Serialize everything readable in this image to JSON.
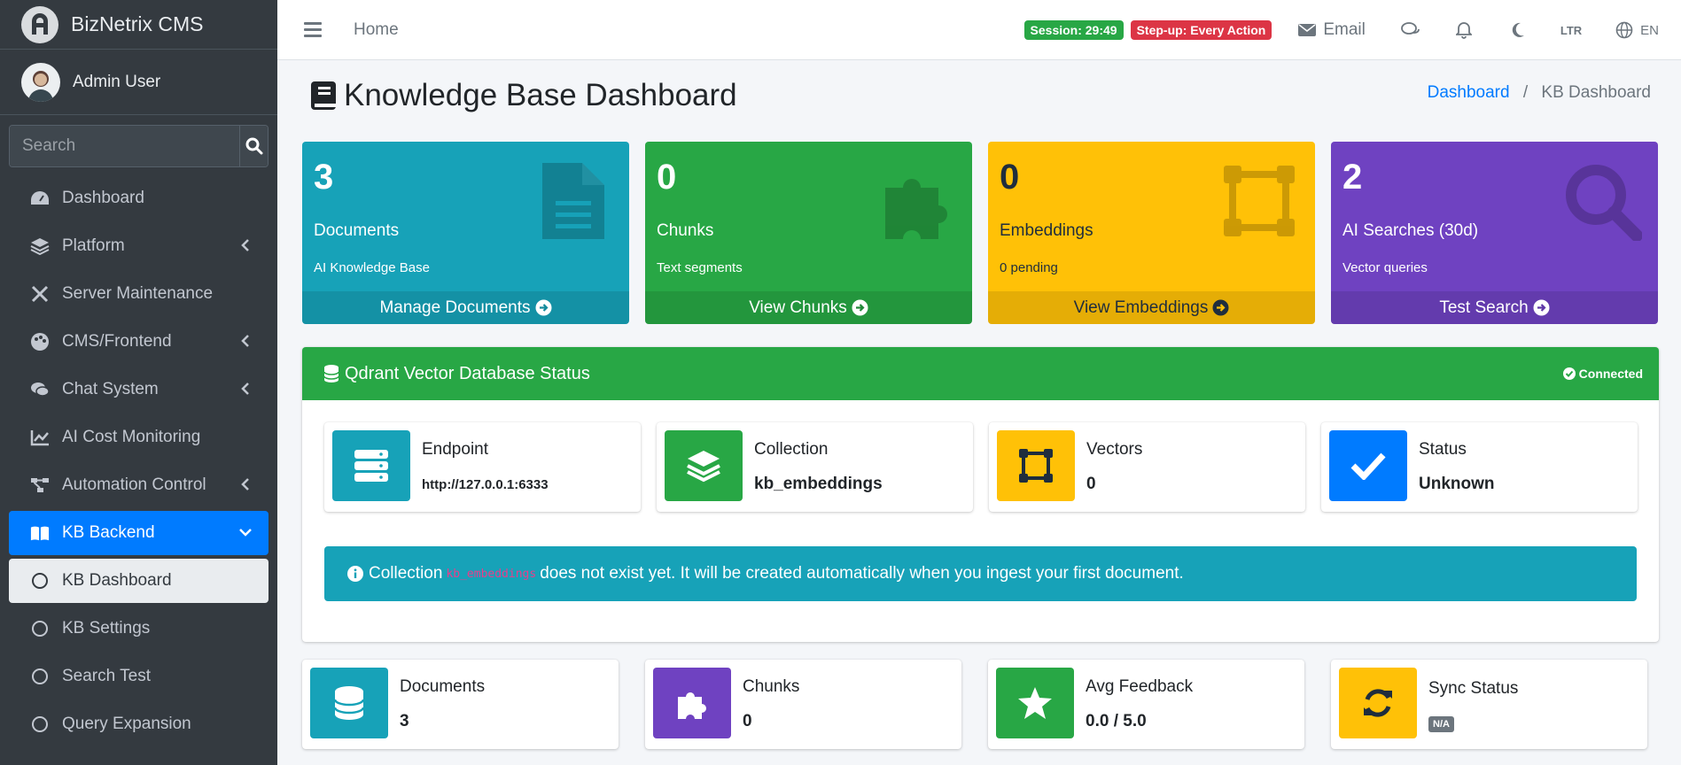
{
  "brand": {
    "name": "BizNetrix CMS"
  },
  "user": {
    "name": "Admin User"
  },
  "sidebar": {
    "search_placeholder": "Search",
    "items": [
      {
        "label": "Dashboard"
      },
      {
        "label": "Platform"
      },
      {
        "label": "Server Maintenance"
      },
      {
        "label": "CMS/Frontend"
      },
      {
        "label": "Chat System"
      },
      {
        "label": "AI Cost Monitoring"
      },
      {
        "label": "Automation Control"
      },
      {
        "label": "KB Backend"
      },
      {
        "label": "KB Dashboard"
      },
      {
        "label": "KB Settings"
      },
      {
        "label": "Search Test"
      },
      {
        "label": "Query Expansion"
      }
    ]
  },
  "topbar": {
    "home": "Home",
    "session_badge": "Session: 29:49",
    "stepup_badge": "Step-up: Every Action",
    "email": "Email",
    "ltr": "LTR",
    "lang": "EN"
  },
  "page": {
    "title": "Knowledge Base Dashboard",
    "breadcrumb_link": "Dashboard",
    "breadcrumb_sep": "/",
    "breadcrumb_current": "KB Dashboard"
  },
  "stats": [
    {
      "number": "3",
      "label": "Documents",
      "sub": "AI Knowledge Base",
      "link": "Manage Documents",
      "color": "#17a2b8"
    },
    {
      "number": "0",
      "label": "Chunks",
      "sub": "Text segments",
      "link": "View Chunks",
      "color": "#28a745"
    },
    {
      "number": "0",
      "label": "Embeddings",
      "sub": "0 pending",
      "link": "View Embeddings",
      "color": "#ffc107"
    },
    {
      "number": "2",
      "label": "AI Searches (30d)",
      "sub": "Vector queries",
      "link": "Test Search",
      "color": "#6f42c1"
    }
  ],
  "qdrant": {
    "title": "Qdrant Vector Database Status",
    "status_badge": "Connected",
    "boxes": [
      {
        "label": "Endpoint",
        "value": "http://127.0.0.1:6333"
      },
      {
        "label": "Collection",
        "value": "kb_embeddings"
      },
      {
        "label": "Vectors",
        "value": "0"
      },
      {
        "label": "Status",
        "value": "Unknown"
      }
    ],
    "callout_before": "Collection",
    "callout_code": "kb_embeddings",
    "callout_after": "does not exist yet. It will be created automatically when you ingest your first document."
  },
  "bottom": [
    {
      "label": "Documents",
      "value": "3"
    },
    {
      "label": "Chunks",
      "value": "0"
    },
    {
      "label": "Avg Feedback",
      "value": "0.0 / 5.0"
    },
    {
      "label": "Sync Status",
      "value": "N/A"
    }
  ]
}
